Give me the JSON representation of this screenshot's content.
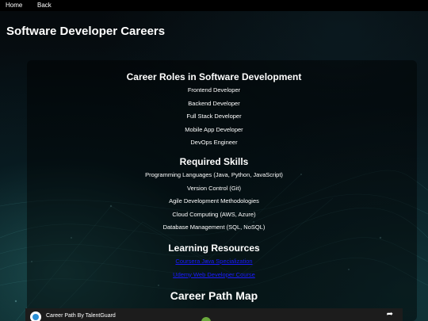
{
  "nav": {
    "home_label": "Home",
    "back_label": "Back"
  },
  "page": {
    "title": "Software Developer Careers"
  },
  "roles": {
    "heading": "Career Roles in Software Development",
    "items": [
      "Frontend Developer",
      "Backend Developer",
      "Full Stack Developer",
      "Mobile App Developer",
      "DevOps Engineer"
    ]
  },
  "skills": {
    "heading": "Required Skills",
    "items": [
      "Programming Languages (Java, Python, JavaScript)",
      "Version Control (Git)",
      "Agile Development Methodologies",
      "Cloud Computing (AWS, Azure)",
      "Database Management (SQL, NoSQL)"
    ]
  },
  "resources": {
    "heading": "Learning Resources",
    "links": [
      "Coursera Java Specialization",
      "Udemy Web Developer Course"
    ]
  },
  "map": {
    "heading": "Career Path Map"
  },
  "video": {
    "title": "Career Path By TalentGuard",
    "share_icon": "share-arrow-icon"
  },
  "colors": {
    "background": "#000000",
    "text": "#ffffff",
    "link": "#1a1aff"
  }
}
